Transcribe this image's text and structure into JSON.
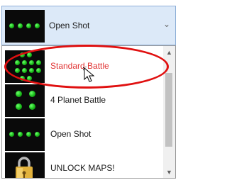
{
  "dropdown": {
    "selected_label": "Open Shot",
    "items": [
      {
        "label": "Standard Battle",
        "color": "#e03030"
      },
      {
        "label": "4 Planet Battle",
        "color": "#1a1a1a"
      },
      {
        "label": "Open Shot",
        "color": "#1a1a1a"
      },
      {
        "label": "UNLOCK MAPS!",
        "color": "#1a1a1a"
      }
    ]
  },
  "icons": {
    "expand": "chevron-down-icon",
    "scroll_up": "triangle-up",
    "scroll_down": "triangle-down",
    "lock": "padlock-icon"
  },
  "colors": {
    "highlight_ring": "#e01010",
    "dot_green": "#22c322",
    "header_bg": "#dce9f8"
  }
}
